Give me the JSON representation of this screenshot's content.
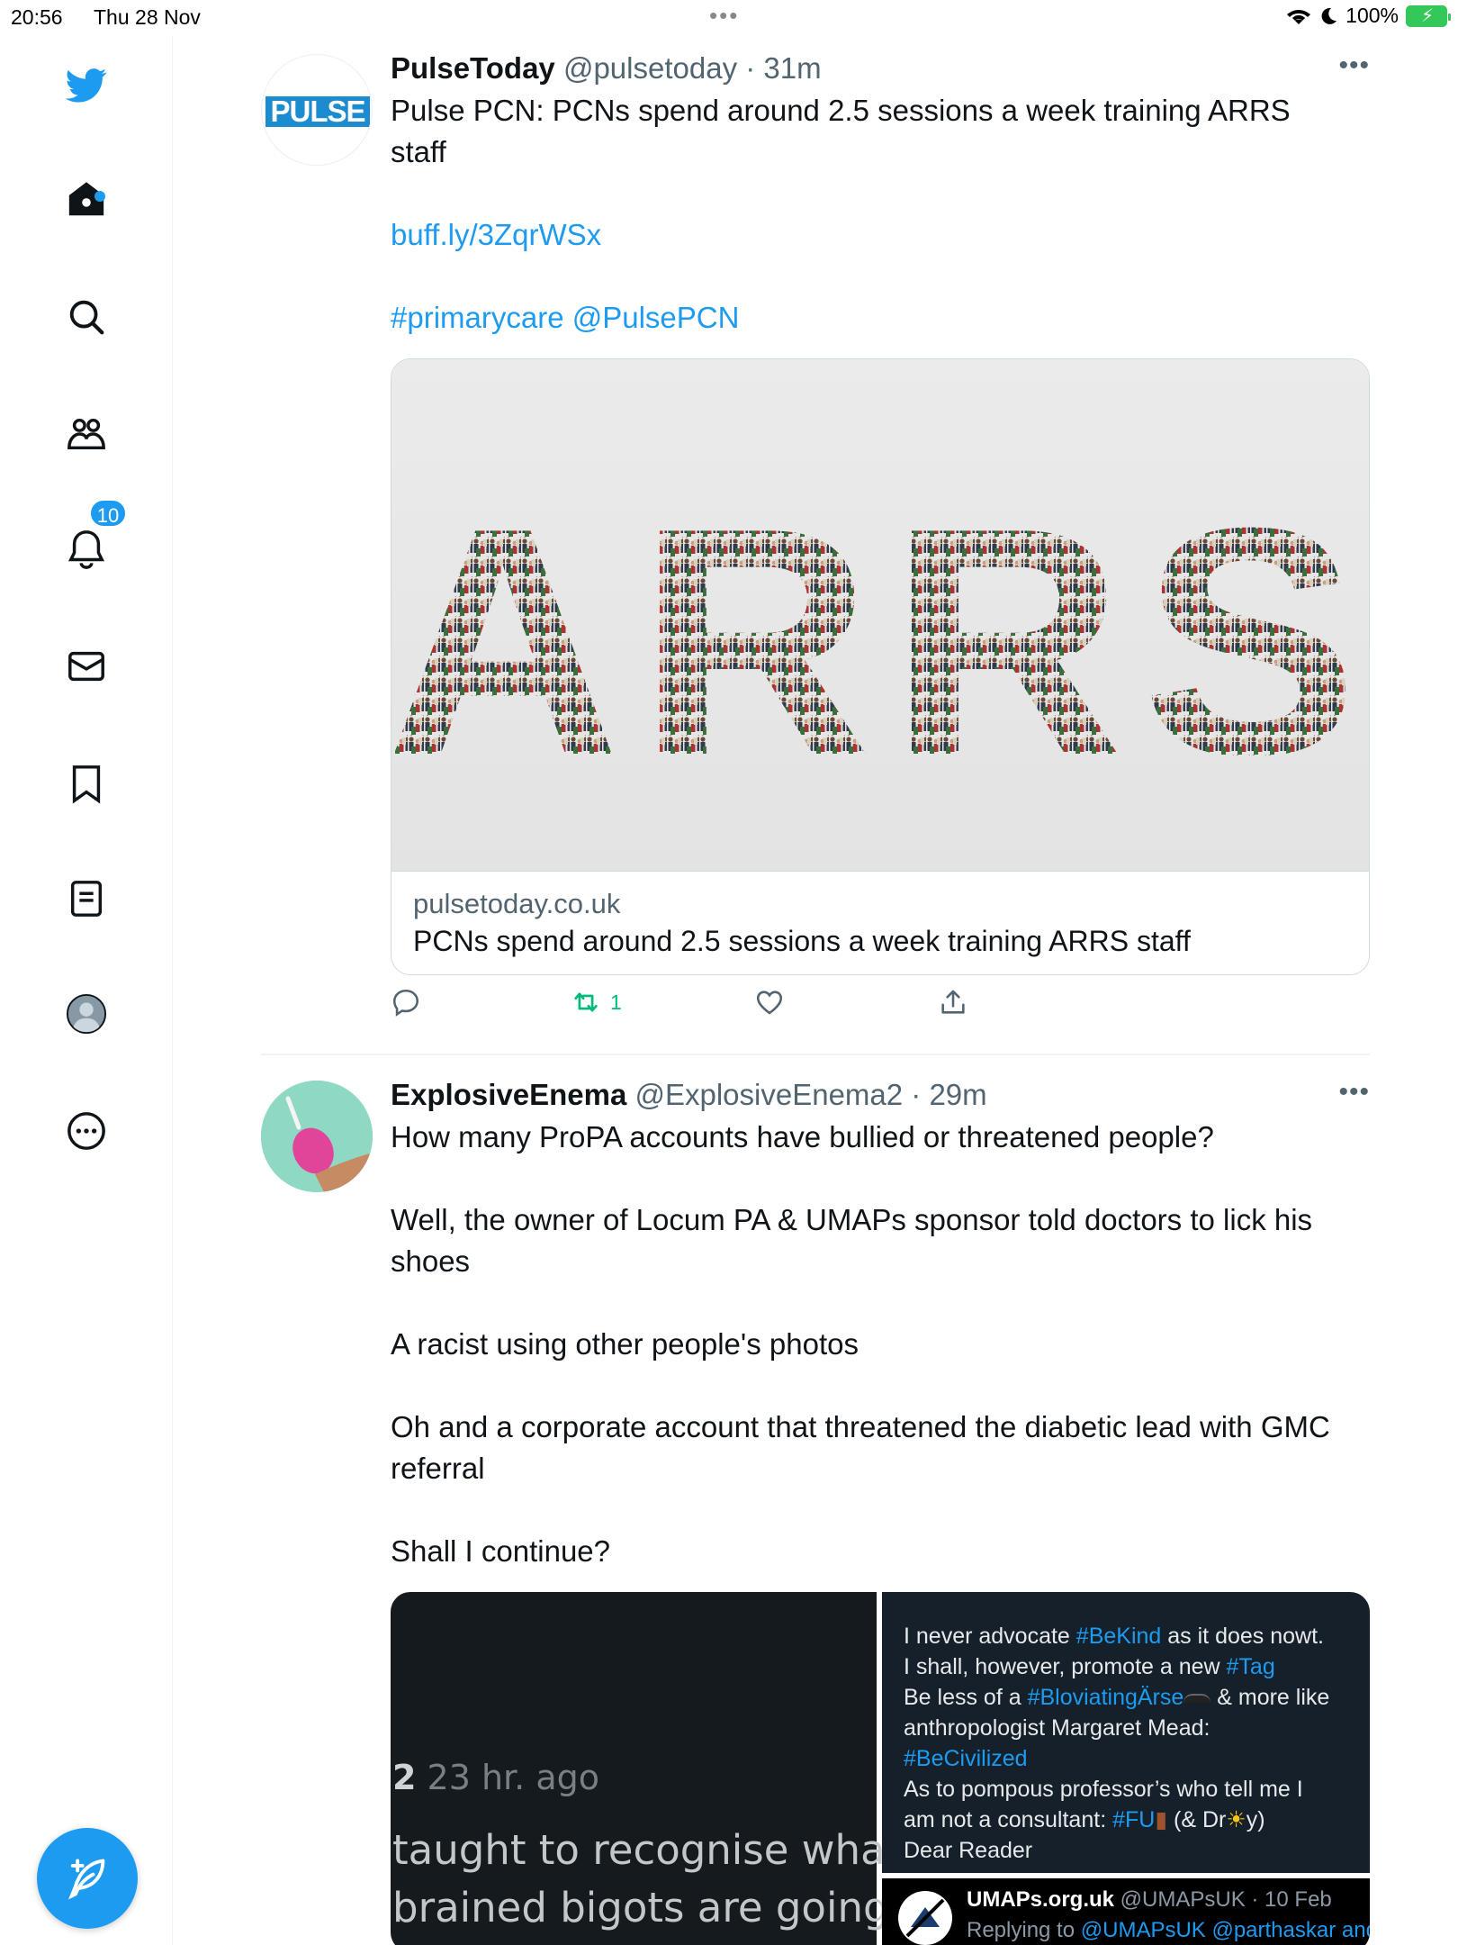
{
  "status_bar": {
    "time": "20:56",
    "date": "Thu 28 Nov",
    "battery": "100%"
  },
  "sidebar": {
    "notifications_badge": "10"
  },
  "tweets": [
    {
      "name": "PulseToday",
      "handle": "@pulsetoday",
      "time": "· 31m",
      "avatar_text": "PULSE",
      "lines": [
        "Pulse PCN: PCNs spend around 2.5 sessions a week training ARRS",
        "staff"
      ],
      "link": "buff.ly/3ZqrWSx",
      "hashtag": "#primarycare",
      "mention": "@PulsePCN",
      "card": {
        "image_text": "ARRS",
        "domain": "pulsetoday.co.uk",
        "title": "PCNs spend around 2.5 sessions a week training ARRS staff"
      },
      "retweet_count": "1"
    },
    {
      "name": "ExplosiveEnema",
      "handle": "@ExplosiveEnema2",
      "time": "· 29m",
      "paragraphs": [
        "How many ProPA accounts have bullied or threatened people?",
        "Well, the owner of Locum PA & UMAPs sponsor told doctors to lick his shoes",
        "A racist using other people's photos",
        "Oh and a corporate account that threatened the diabetic lead with GMC referral",
        "Shall I continue?"
      ],
      "media_left": {
        "line1_bold": "2",
        "line1": " 23 hr. ago",
        "line2": "taught to recognise what they",
        "line3": "brained bigots are going to p"
      },
      "media_right": {
        "l1a": "I never advocate ",
        "l1b": "#BeKind",
        "l1c": " as it does nowt.",
        "l2a": "I shall, however, promote a new ",
        "l2b": "#Tag",
        "l3a": "Be less of a ",
        "l3b": "#BloviatingÄrse",
        "l3c": " & more like",
        "l4": "anthropologist Margaret Mead:",
        "l5": "#BeCivilized",
        "l6": "As to pompous professor’s who tell me I",
        "l7a": "am not a consultant: ",
        "l7b": "#FU",
        "l7c": " (& Dr",
        "l7d": "y)",
        "l8": "Dear Reader",
        "quote_name": "UMAPs.org.uk",
        "quote_meta": " @UMAPsUK · 10 Feb",
        "quote_reply": "Replying to ",
        "quote_reply_handles": "@UMAPsUK @parthaskar and"
      }
    }
  ],
  "colors": {
    "accent": "#1d9bf0",
    "retweet": "#00ba7c",
    "secondary_text": "#536471"
  }
}
